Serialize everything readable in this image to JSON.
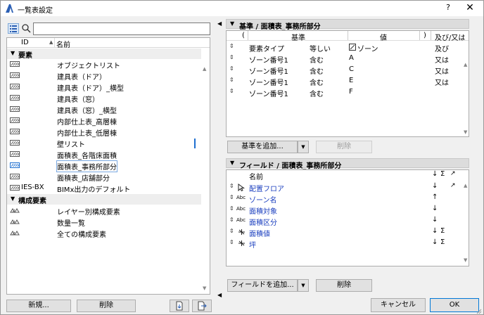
{
  "title": "一覧表設定",
  "titlebar": {
    "help": "?",
    "close": "✕"
  },
  "left": {
    "search_placeholder": "",
    "col_id": "ID",
    "col_name": "名前",
    "groups": [
      {
        "label": "要素",
        "items": [
          {
            "id": "",
            "name": "オブジェクトリスト"
          },
          {
            "id": "",
            "name": "建具表（ドア）"
          },
          {
            "id": "",
            "name": "建具表（ドア）_横型"
          },
          {
            "id": "",
            "name": "建具表（窓）"
          },
          {
            "id": "",
            "name": "建具表（窓）_横型"
          },
          {
            "id": "",
            "name": "内部仕上表_高層棟"
          },
          {
            "id": "",
            "name": "内部仕上表_低層棟"
          },
          {
            "id": "",
            "name": "壁リスト"
          },
          {
            "id": "",
            "name": "面積表_各階床面積"
          },
          {
            "id": "",
            "name": "面積表_事務所部分"
          },
          {
            "id": "",
            "name": "面積表_店舗部分"
          },
          {
            "id": "IES-BX",
            "name": "BIMx出力のデフォルト"
          }
        ]
      },
      {
        "label": "構成要素",
        "items": [
          {
            "id": "",
            "name": "レイヤー別構成要素"
          },
          {
            "id": "",
            "name": "数量一覧"
          },
          {
            "id": "",
            "name": "全ての構成要素"
          }
        ]
      }
    ],
    "new_btn": "新規...",
    "delete_btn": "削除"
  },
  "criteria": {
    "title": "基準 / 面積表_事務所部分",
    "headers": {
      "open": "(",
      "criterion": "基準",
      "value": "値",
      "close": ")",
      "andor": "及び/又は"
    },
    "rows": [
      {
        "criterion": "要素タイプ",
        "op": "等しい",
        "value": "ゾーン",
        "andor": "及び"
      },
      {
        "criterion": "ゾーン番号1",
        "op": "含む",
        "value": "A",
        "andor": "又は"
      },
      {
        "criterion": "ゾーン番号1",
        "op": "含む",
        "value": "C",
        "andor": "又は"
      },
      {
        "criterion": "ゾーン番号1",
        "op": "含む",
        "value": "E",
        "andor": "又は"
      },
      {
        "criterion": "ゾーン番号1",
        "op": "含む",
        "value": "F",
        "andor": ""
      }
    ],
    "add_btn": "基準を追加...",
    "delete_btn": "削除"
  },
  "fields": {
    "title": "フィールド / 面積表_事務所部分",
    "header_name": "名前",
    "rows": [
      {
        "name": "配置フロア",
        "type": "arrow",
        "sort": "↓",
        "sum": "",
        "pin": "pin"
      },
      {
        "name": "ゾーン名",
        "type": "abc",
        "sort": "↑",
        "sum": "",
        "pin": ""
      },
      {
        "name": "面積対象",
        "type": "abc",
        "sort": "↓",
        "sum": "",
        "pin": ""
      },
      {
        "name": "面積区分",
        "type": "abc",
        "sort": "↓",
        "sum": "",
        "pin": ""
      },
      {
        "name": "面積値",
        "type": "num",
        "sort": "↓",
        "sum": "Σ",
        "pin": ""
      },
      {
        "name": "坪",
        "type": "num",
        "sort": "↓",
        "sum": "Σ",
        "pin": ""
      }
    ],
    "add_btn": "フィールドを追加...",
    "delete_btn": "削除"
  },
  "footer": {
    "cancel": "キャンセル",
    "ok": "OK"
  }
}
